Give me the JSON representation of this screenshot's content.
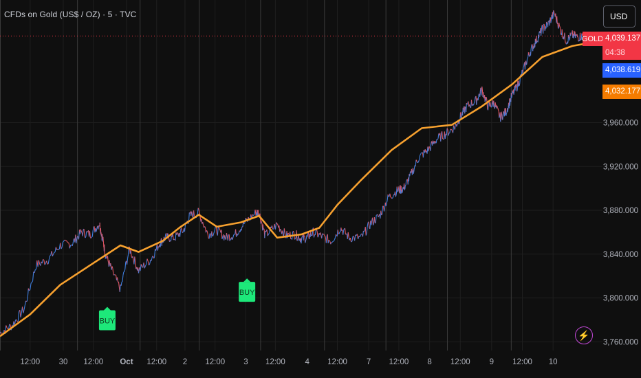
{
  "header": {
    "title": "CFDs on Gold (US$ / OZ) · 5 · TVC",
    "currency_button": "USD"
  },
  "price_labels": {
    "symbol": "GOLD",
    "last_price": "4,039.137",
    "countdown": "04:38",
    "blue_value": "4,038.619",
    "orange_value": "4,032.177"
  },
  "colors": {
    "background": "#0f0f0f",
    "grid": "#1f1f1f",
    "session_line": "#3a3a3a",
    "price_line_blue": "#3f7fe0",
    "price_line_red": "#e2545f",
    "ma_line": "#f7a12f",
    "buy_marker": "#1de87a",
    "last_price_red": "#f23645",
    "blue_tag": "#2962ff",
    "orange_tag": "#f57c00"
  },
  "chart_data": {
    "type": "line",
    "title": "CFDs on Gold (US$ / OZ) · 5 · TVC",
    "ylim": [
      3752,
      4072
    ],
    "y_ticks": [
      "3,760.000",
      "3,800.000",
      "3,840.000",
      "3,880.000",
      "3,920.000",
      "3,960.000"
    ],
    "x_tick_labels": [
      "12:00",
      "30",
      "12:00",
      "Oct",
      "12:00",
      "2",
      "12:00",
      "3",
      "12:00",
      "4",
      "12:00",
      "7",
      "12:00",
      "8",
      "12:00",
      "9",
      "12:00",
      "10"
    ],
    "x_tick_bold": [
      false,
      false,
      false,
      true,
      false,
      false,
      false,
      false,
      false,
      false,
      false,
      false,
      false,
      false,
      false,
      false,
      false,
      false
    ],
    "x_tick_pos": [
      0.05,
      0.105,
      0.155,
      0.21,
      0.26,
      0.307,
      0.357,
      0.408,
      0.457,
      0.51,
      0.56,
      0.612,
      0.662,
      0.713,
      0.764,
      0.816,
      0.867,
      0.918
    ],
    "session_positions": [
      0.0,
      0.128,
      0.232,
      0.33,
      0.432,
      0.538,
      0.64,
      0.742,
      0.848
    ],
    "series": [
      {
        "kind": "price",
        "x": [
          0,
          0.02,
          0.04,
          0.06,
          0.08,
          0.1,
          0.12,
          0.135,
          0.15,
          0.165,
          0.17,
          0.175,
          0.185,
          0.2,
          0.215,
          0.23,
          0.25,
          0.265,
          0.275,
          0.29,
          0.305,
          0.315,
          0.33,
          0.345,
          0.36,
          0.375,
          0.39,
          0.405,
          0.425,
          0.43,
          0.44,
          0.46,
          0.475,
          0.49,
          0.5,
          0.51,
          0.52,
          0.535,
          0.55,
          0.565,
          0.58,
          0.6,
          0.615,
          0.63,
          0.645,
          0.66,
          0.67,
          0.68,
          0.695,
          0.71,
          0.725,
          0.74,
          0.755,
          0.765,
          0.775,
          0.79,
          0.8,
          0.81,
          0.82,
          0.83,
          0.84,
          0.85,
          0.86,
          0.87,
          0.88,
          0.89,
          0.9,
          0.91,
          0.92,
          0.93,
          0.94,
          0.95,
          0.96,
          0.97
        ],
        "y": [
          3768,
          3775,
          3790,
          3830,
          3835,
          3848,
          3850,
          3860,
          3858,
          3868,
          3855,
          3840,
          3826,
          3808,
          3845,
          3825,
          3835,
          3850,
          3855,
          3855,
          3862,
          3875,
          3878,
          3858,
          3862,
          3855,
          3858,
          3868,
          3878,
          3878,
          3857,
          3867,
          3857,
          3858,
          3854,
          3855,
          3860,
          3856,
          3852,
          3864,
          3855,
          3855,
          3868,
          3875,
          3892,
          3898,
          3900,
          3910,
          3928,
          3935,
          3945,
          3950,
          3956,
          3966,
          3975,
          3980,
          3990,
          3975,
          3978,
          3965,
          3970,
          3985,
          3995,
          4010,
          4025,
          4035,
          4045,
          4050,
          4060,
          4045,
          4035,
          4040,
          4038,
          4040
        ]
      },
      {
        "kind": "ma",
        "x": [
          0,
          0.05,
          0.1,
          0.15,
          0.2,
          0.23,
          0.27,
          0.3,
          0.33,
          0.36,
          0.4,
          0.43,
          0.46,
          0.5,
          0.53,
          0.56,
          0.6,
          0.65,
          0.7,
          0.75,
          0.8,
          0.85,
          0.9,
          0.95,
          0.97
        ],
        "y": [
          3765,
          3785,
          3812,
          3830,
          3848,
          3842,
          3852,
          3865,
          3876,
          3865,
          3869,
          3875,
          3855,
          3858,
          3864,
          3885,
          3908,
          3935,
          3955,
          3958,
          3975,
          3995,
          4020,
          4030,
          4032
        ]
      }
    ],
    "annotations": [
      {
        "label": "BUY",
        "x": 0.178,
        "y": 3800
      },
      {
        "label": "BUY",
        "x": 0.41,
        "y": 3826
      }
    ],
    "last_price": 4039.137
  }
}
